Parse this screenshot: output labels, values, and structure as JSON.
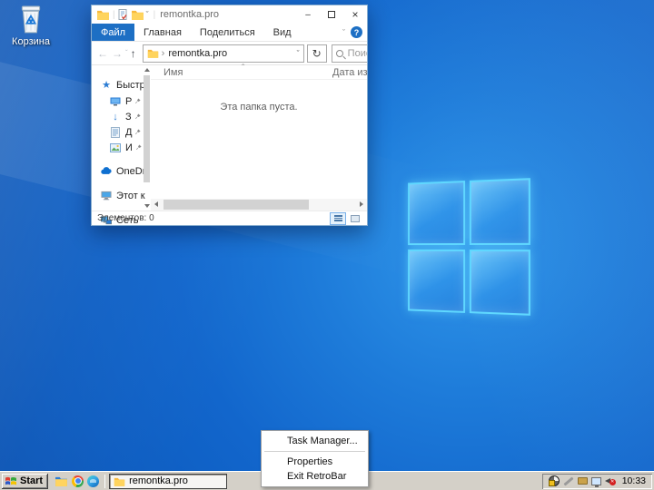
{
  "glyphs": {
    "minimize": "–",
    "close": "×",
    "chevron_down": "ˇ",
    "sort_caret": "ˆ",
    "back": "←",
    "forward": "→",
    "up": "↑",
    "refresh": "↻",
    "breadcrumb": "›",
    "help": "?",
    "quick_access_star": "★",
    "download_arrow": "↓"
  },
  "desktop": {
    "recycle_bin_label": "Корзина"
  },
  "explorer": {
    "window_title": "remontka.pro",
    "ribbon": {
      "tabs": [
        {
          "label": "Файл"
        },
        {
          "label": "Главная"
        },
        {
          "label": "Поделиться"
        },
        {
          "label": "Вид"
        }
      ]
    },
    "addressbar": {
      "path_crumb": "remontka.pro",
      "search_text": "Поиск: remontka.pro"
    },
    "sidebar": {
      "items": [
        {
          "label": "Быстр"
        },
        {
          "label": "Р"
        },
        {
          "label": "З"
        },
        {
          "label": "Д"
        },
        {
          "label": "И"
        },
        {
          "label": "OneDr"
        },
        {
          "label": "Этот к"
        },
        {
          "label": "Сеть"
        }
      ]
    },
    "main": {
      "columns": [
        {
          "label": "Имя"
        },
        {
          "label": "Дата изме"
        }
      ],
      "empty_text": "Эта папка пуста."
    },
    "statusbar": {
      "items_count": "Элементов: 0"
    }
  },
  "context_menu": {
    "items": [
      {
        "label": "Task Manager..."
      },
      {
        "label": "Properties"
      },
      {
        "label": "Exit RetroBar"
      }
    ]
  },
  "taskbar": {
    "start_label": "Start",
    "task_button_label": "remontka.pro",
    "clock": "10:33"
  },
  "colors": {
    "accent": "#1d6fc4",
    "wallpaper_base": "#1266cc",
    "logo_border": "#5fd8ff",
    "taskbar_face": "#d4d0c8"
  }
}
